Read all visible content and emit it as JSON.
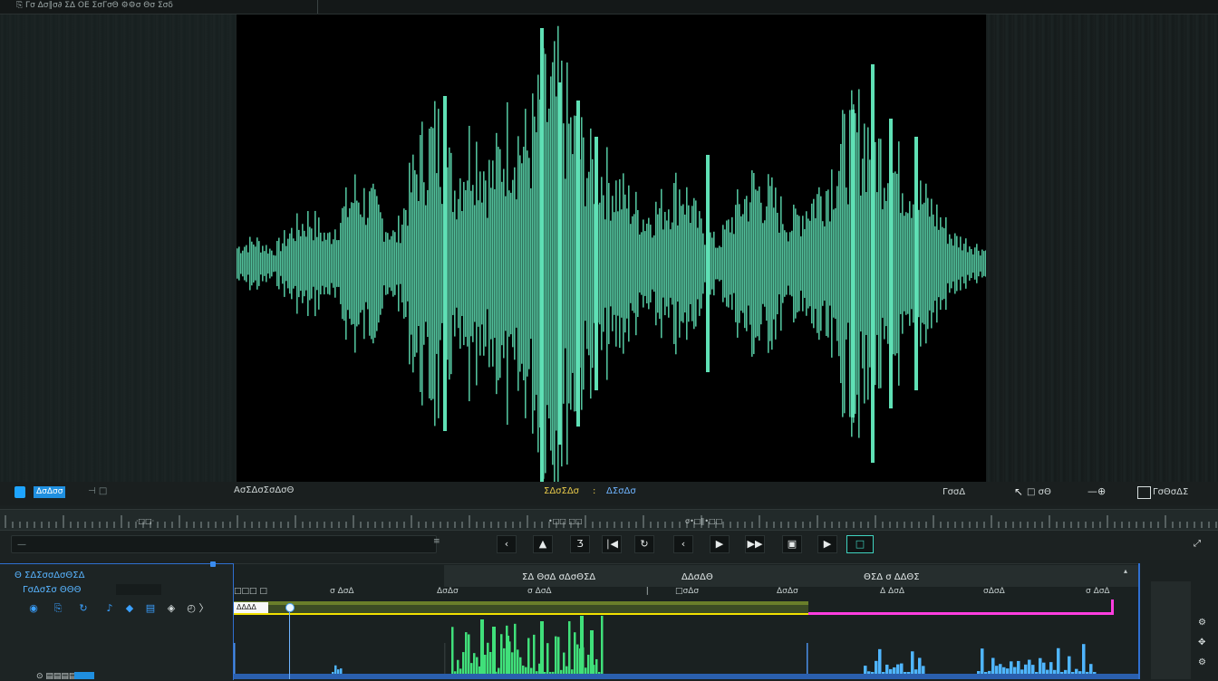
{
  "app": {
    "topbar_title": "⎘ Γσ Δσ∥σ∂ ΣΔ ΟΕ ΣσΓσΘ ⚙⚙σ Θσ Σσδ"
  },
  "info_bar": {
    "badge_label": "ΔσΔσσ",
    "badge_sep": "⊣ □",
    "clip_name": "ΑσΣΔσΣσΔσΘ",
    "status_warn": "ΣΔσΣΔσ",
    "status_sep": ":",
    "status_info": "ΔΣσΔσ",
    "right_label": "ΓσσΔ",
    "cursor_icon": "↖",
    "snap_label": "□ σΘ",
    "zoom_icon": "—⊕",
    "panel_label": "ΓσΘσΔΣ"
  },
  "ruler": {
    "labels": [
      {
        "text": "·□□·",
        "pos": "left"
      },
      {
        "text": "•□□ □□",
        "pos": "mid"
      },
      {
        "text": "σ•□∥•□□",
        "pos": "right"
      }
    ]
  },
  "controls": {
    "search_placeholder": "—",
    "search_end": "≡",
    "buttons": [
      {
        "name": "step-back-button",
        "glyph": "‹"
      },
      {
        "name": "marker-button",
        "glyph": "▲"
      },
      {
        "name": "trim-button",
        "glyph": "Ʒ"
      },
      {
        "name": "prev-edit-button",
        "glyph": "∣◀"
      },
      {
        "name": "loop-button",
        "glyph": "↻"
      },
      {
        "name": "previous-button",
        "glyph": "‹"
      },
      {
        "name": "play-button",
        "glyph": "▶"
      },
      {
        "name": "next-frame-button",
        "glyph": "▶▶"
      },
      {
        "name": "export-frame-button",
        "glyph": "▣"
      },
      {
        "name": "forward-button",
        "glyph": "▶"
      },
      {
        "name": "safe-margins-button",
        "glyph": "□"
      }
    ],
    "fullscreen_glyph": "⤢"
  },
  "track_panel": {
    "title": "Θ ΣΔΣσσΔσΘΣΔ",
    "subtitle": "ΓσΔσΣσ ΘΘΘ",
    "icons": [
      {
        "name": "visibility-icon",
        "glyph": "◉",
        "color": "#3aa0ff"
      },
      {
        "name": "sync-lock-icon",
        "glyph": "⎘",
        "color": "#3aa0ff"
      },
      {
        "name": "loop-icon",
        "glyph": "↻",
        "color": "#3aa0ff"
      },
      {
        "name": "mute-icon",
        "glyph": "♪",
        "color": "#3aa0ff"
      },
      {
        "name": "volume-icon",
        "glyph": "◆",
        "color": "#3aa0ff"
      },
      {
        "name": "solo-icon",
        "glyph": "▤",
        "color": "#3aa0ff"
      },
      {
        "name": "record-icon",
        "glyph": "◈",
        "color": "#d7dede"
      },
      {
        "name": "clock-icon",
        "glyph": "◴",
        "color": "#d7dede"
      },
      {
        "name": "expand-icon",
        "glyph": "〉",
        "color": "#d7dede"
      }
    ],
    "bottom_row": "⊙  ▤▤▤▤"
  },
  "timeline": {
    "headers": [
      {
        "text": "ΣΔ ΘσΔ σΔσΘΣΔ",
        "pos": "h1"
      },
      {
        "text": "ΔΔσΔΘ",
        "pos": "h2"
      },
      {
        "text": "ΘΣΔ σ ΔΔΘΣ",
        "pos": "h3"
      }
    ],
    "time_labels": [
      "□□□ □",
      "σ ΔσΔ",
      "ΔσΔσ",
      "σ ΔσΔ",
      "∣",
      "□σΔσ",
      "ΔσΔσ",
      "Δ ΔσΔ",
      "σΔσΔ",
      "σ ΔσΔ"
    ],
    "selection_label": "ΔΔΔΔ"
  },
  "waveform": {
    "color": "#5fe0b5",
    "clip_color": "#40e07a",
    "clip_color_2": "#4fb5ff"
  },
  "colors": {
    "accent_blue": "#2f6fd0",
    "selection_yellow": "#f2e100",
    "magenta": "#ff3de0"
  }
}
